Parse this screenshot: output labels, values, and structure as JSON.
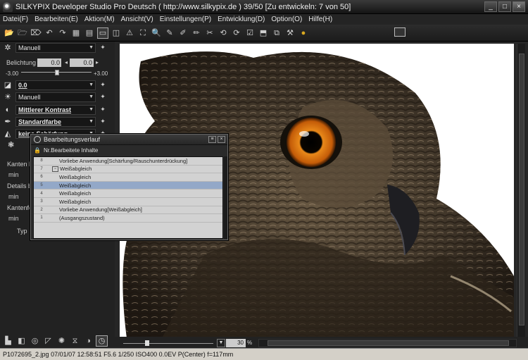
{
  "window": {
    "title": "SILKYPIX Developer Studio Pro Deutsch ( http://www.silkypix.de )   39/50 [Zu entwickeln: 7 von 50]",
    "min": "_",
    "max": "□",
    "close": "×"
  },
  "menu": [
    "Datei(F)",
    "Bearbeiten(E)",
    "Aktion(M)",
    "Ansicht(V)",
    "Einstellungen(P)",
    "Entwicklung(D)",
    "Option(O)",
    "Hilfe(H)"
  ],
  "left_panel": {
    "wb_select": "Manuell",
    "exposure_label": "Belichtung",
    "exposure_value": "0.0",
    "exposure_value2": "0.0",
    "range_min": "-3.00",
    "range_max": "+3.00",
    "tone_select": "0.0",
    "tone2_select": "Manuell",
    "contrast_select": "Mittlerer Kontrast",
    "color_select": "Standardfarbe",
    "sharpness_select": "keine Schärfung",
    "side_labels": [
      "Kanten b",
      "min",
      "Details b",
      "min",
      "Kantenfe",
      "min",
      "Typ"
    ]
  },
  "history_dialog": {
    "title": "Bearbeitungsverlauf",
    "column_header": "Nr.Bearbeitete Inhalte",
    "rows": [
      {
        "num": "8",
        "text": "Vorliebe Anwendung[Schärfung/Rauschunterdrückung]",
        "mark": ""
      },
      {
        "num": "7",
        "text": "Weißabgleich",
        "mark": "−"
      },
      {
        "num": "6",
        "text": "Weißabgleich",
        "mark": ""
      },
      {
        "num": "5",
        "text": "Weißabgleich",
        "mark": ""
      },
      {
        "num": "4",
        "text": "Weißabgleich",
        "mark": ""
      },
      {
        "num": "3",
        "text": "Weißabgleich",
        "mark": ""
      },
      {
        "num": "2",
        "text": "Vorliebe Anwendung[Weißabgleich]",
        "mark": ""
      },
      {
        "num": "1",
        "text": "(Ausgangszustand)",
        "mark": ""
      }
    ],
    "selected_row": 3
  },
  "zoom": {
    "value": "30",
    "unit": "%"
  },
  "status": {
    "text": "P1072695_2.jpg 07/01/07 12:58:51 F5.6 1/250 ISO400  0.0EV P(Center) f=117mm"
  },
  "colors": {
    "selection": "#93a8c8",
    "panel_bg": "#222222",
    "owl_eye": "#e07a10"
  }
}
